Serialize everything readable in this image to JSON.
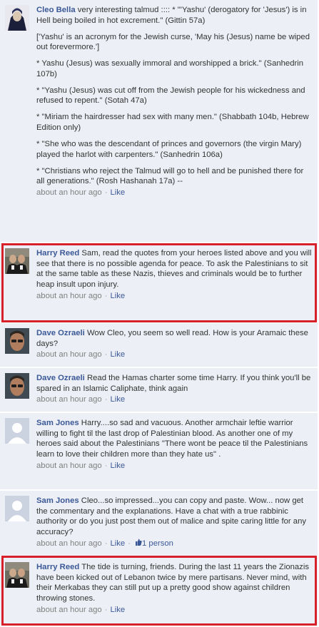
{
  "comments": [
    {
      "author": "Cleo Bella",
      "paras": [
        " very interesting talmud :::: * \"'Yashu' (derogatory for 'Jesus') is in Hell being boiled in hot excrement.\" (Gittin 57a)",
        "['Yashu' is an acronym for the Jewish curse, 'May his (Jesus) name be wiped out forevermore.']",
        "* Yashu (Jesus) was sexually immoral and worshipped a brick.\" (Sanhedrin 107b)",
        "* \"Yashu (Jesus) was cut off from the Jewish people for his wickedness and refused to repent.\" (Sotah 47a)",
        "* \"Miriam the hairdresser had sex with many men.\" (Shabbath 104b, Hebrew Edition only)",
        "* \"She who was the descendant of princes and governors (the virgin Mary) played the harlot with carpenters.\" (Sanhedrin 106a)",
        "* \"Christians who reject the Talmud will go to hell and be punished there for all generations.\" (Rosh Hashanah 17a) --"
      ],
      "time": "about an hour ago",
      "like": "Like"
    },
    {
      "author": "Harry Reed",
      "paras": [
        " Sam, read the quotes from your heroes listed above and you will see that there is no possible agenda for peace. To ask the Palestinians to sit at the same table as these Nazis, thieves and criminals would be to further heap insult upon injury."
      ],
      "time": "about an hour ago",
      "like": "Like"
    },
    {
      "author": "Dave Ozraeli",
      "paras": [
        " Wow Cleo, you seem so well read. How is your Aramaic these days?"
      ],
      "time": "about an hour ago",
      "like": "Like"
    },
    {
      "author": "Dave Ozraeli",
      "paras": [
        " Read the Hamas charter some time Harry. If you think you'll be spared in an Islamic Caliphate, think again"
      ],
      "time": "about an hour ago",
      "like": "Like"
    },
    {
      "author": "Sam Jones",
      "paras": [
        " Harry....so sad and vacuous. Another armchair leftie warrior willing to fight til the last drop of Palestinian blood. As another one of my heroes said about the Palestinians \"There wont be peace til the Palestinians learn to love their children more than they hate us\" ."
      ],
      "time": "about an hour ago",
      "like": "Like"
    },
    {
      "author": "Sam Jones",
      "paras": [
        " Cleo...so impressed...you can copy and paste. Wow... now get the commentary and the explanations. Have a chat with a true rabbinic authority or do you just post them out of malice and spite caring little for any accuracy?"
      ],
      "time": "about an hour ago",
      "like": "Like",
      "likes_count": "1 person"
    },
    {
      "author": "Harry Reed",
      "paras": [
        " The tide is turning, friends. During the last 11 years the Zionazis have been kicked out of Lebanon twice by mere partisans. Never mind, with their Merkabas they can still put up a pretty good show against children throwing stones."
      ],
      "time": "about an hour ago",
      "like": "Like"
    }
  ],
  "colors": {
    "author": "#3b5998",
    "background": "#eceff5",
    "highlight": "#d8202a"
  }
}
